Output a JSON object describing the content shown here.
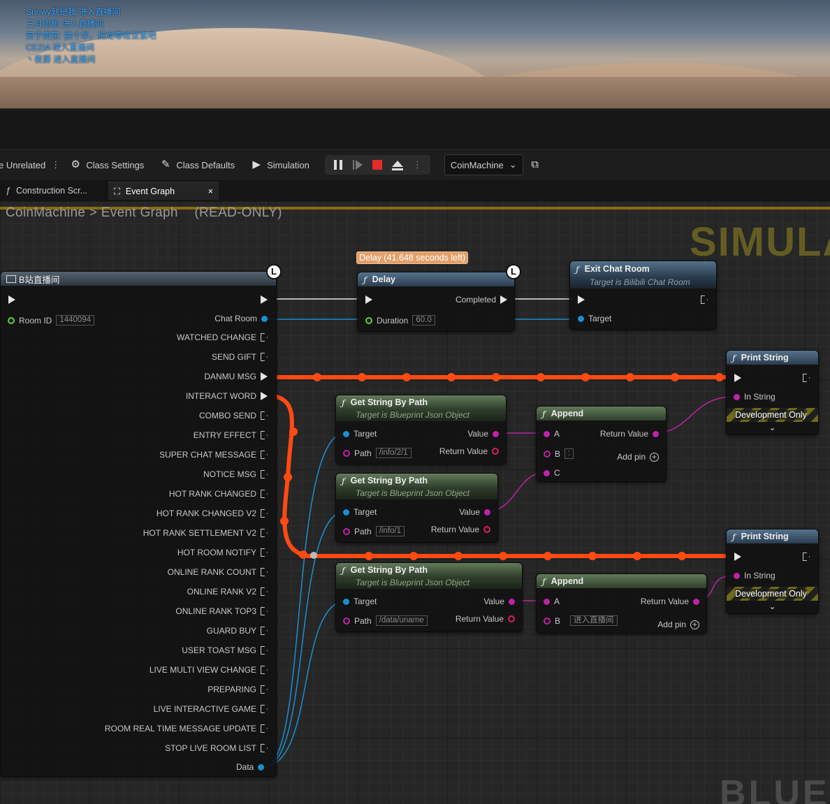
{
  "chat_overlay": [
    "Snowy就是我 进入直播间",
    "三月雨鱼 进入直播间",
    "安于南笙: 换个羊，把龙尊给亚索吧",
    "CEZIA 进入直播间",
    "丶夜爵 进入直播间"
  ],
  "toolbar": {
    "unrelated": "e Unrelated",
    "class_settings": "Class Settings",
    "class_defaults": "Class Defaults",
    "simulation": "Simulation",
    "debug_object": "CoinMachine"
  },
  "tabs": [
    {
      "label": "Construction Scr..."
    },
    {
      "label": "Event Graph",
      "close": "×"
    }
  ],
  "breadcrumb": {
    "blueprint": "CoinMachine",
    "sep": ">",
    "graph": "Event Graph",
    "mode": "(READ-ONLY)"
  },
  "watermark": {
    "top": "SIMULA",
    "bottom": "BLUEP"
  },
  "event_node": {
    "title": "B站直播间",
    "room_id_label": "Room ID",
    "room_id_value": "1440094",
    "chat_room": "Chat Room",
    "outputs": [
      "WATCHED CHANGE",
      "SEND GIFT",
      "DANMU MSG",
      "INTERACT WORD",
      "COMBO SEND",
      "ENTRY EFFECT",
      "SUPER CHAT MESSAGE",
      "NOTICE MSG",
      "HOT RANK CHANGED",
      "HOT RANK CHANGED V2",
      "HOT RANK SETTLEMENT V2",
      "HOT ROOM NOTIFY",
      "ONLINE RANK COUNT",
      "ONLINE RANK V2",
      "ONLINE RANK TOP3",
      "GUARD BUY",
      "USER TOAST MSG",
      "LIVE MULTI VIEW CHANGE",
      "PREPARING",
      "LIVE INTERACTIVE GAME",
      "ROOM REAL TIME MESSAGE UPDATE",
      "STOP LIVE ROOM LIST"
    ],
    "data": "Data"
  },
  "delay": {
    "tooltip": "Delay (41.648 seconds left)",
    "title": "Delay",
    "completed": "Completed",
    "duration_label": "Duration",
    "duration_value": "60.0"
  },
  "exit_chat": {
    "title": "Exit Chat Room",
    "subtitle": "Target is Bilibili Chat Room",
    "target": "Target"
  },
  "get_string_nodes": [
    {
      "title": "Get String By Path",
      "subtitle": "Target is Blueprint Json Object",
      "target": "Target",
      "value": "Value",
      "path_label": "Path",
      "path_value": "/info/2/1",
      "return": "Return Value"
    },
    {
      "title": "Get String By Path",
      "subtitle": "Target is Blueprint Json Object",
      "target": "Target",
      "value": "Value",
      "path_label": "Path",
      "path_value": "/info/1",
      "return": "Return Value"
    },
    {
      "title": "Get String By Path",
      "subtitle": "Target is Blueprint Json Object",
      "target": "Target",
      "value": "Value",
      "path_label": "Path",
      "path_value": "/data/uname",
      "return": "Return Value"
    }
  ],
  "append_nodes": [
    {
      "title": "Append",
      "a": "A",
      "b": "B",
      "b_value": ":",
      "c": "C",
      "return": "Return Value",
      "add_pin": "Add pin"
    },
    {
      "title": "Append",
      "a": "A",
      "b": "B",
      "b_value": "进入直播间",
      "return": "Return Value",
      "add_pin": "Add pin"
    }
  ],
  "print_nodes": [
    {
      "title": "Print String",
      "in_string": "In String",
      "dev": "Development Only"
    },
    {
      "title": "Print String",
      "in_string": "In String",
      "dev": "Development Only"
    }
  ],
  "colors": {
    "exec_wire": "#ff4a12",
    "object_pin": "#1b8fd1",
    "string_pin": "#c022a8",
    "int_pin": "#5fd33b",
    "watermark": "#6b6322"
  }
}
